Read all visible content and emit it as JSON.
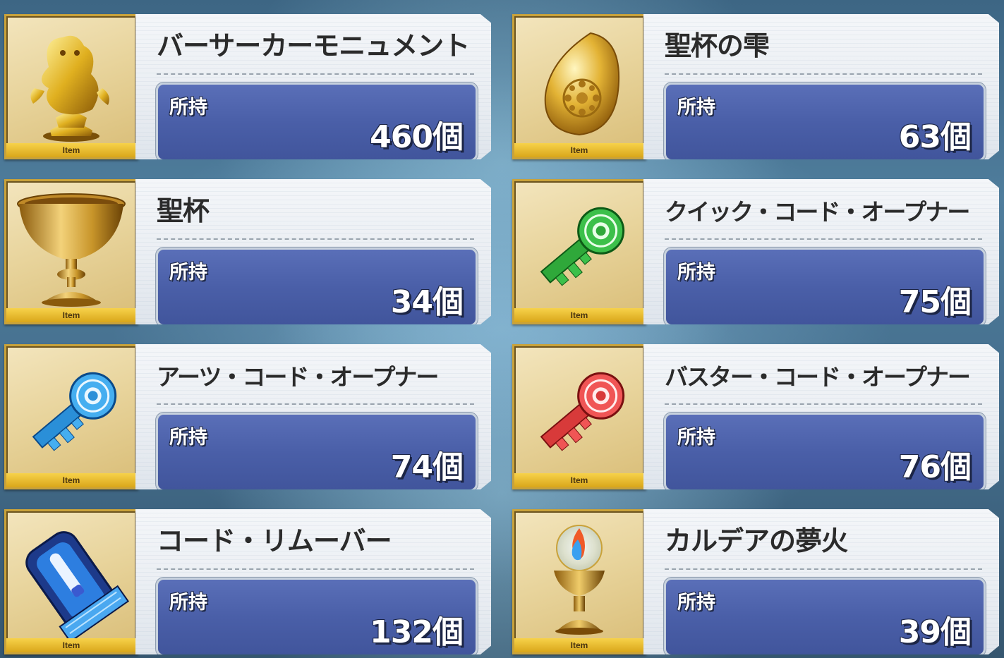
{
  "item_tag": "Item",
  "count_label": "所持",
  "items": [
    {
      "name": "バーサーカーモニュメント",
      "count": "460個",
      "icon": "berserker-monument-icon"
    },
    {
      "name": "聖杯の雫",
      "count": "63個",
      "icon": "grail-drop-icon"
    },
    {
      "name": "聖杯",
      "count": "34個",
      "icon": "holy-grail-icon"
    },
    {
      "name": "クイック・コード・オープナー",
      "count": "75個",
      "icon": "quick-code-opener-icon"
    },
    {
      "name": "アーツ・コード・オープナー",
      "count": "74個",
      "icon": "arts-code-opener-icon"
    },
    {
      "name": "バスター・コード・オープナー",
      "count": "76個",
      "icon": "buster-code-opener-icon"
    },
    {
      "name": "コード・リムーバー",
      "count": "132個",
      "icon": "code-remover-icon"
    },
    {
      "name": "カルデアの夢火",
      "count": "39個",
      "icon": "chaldea-lantern-icon"
    }
  ]
}
